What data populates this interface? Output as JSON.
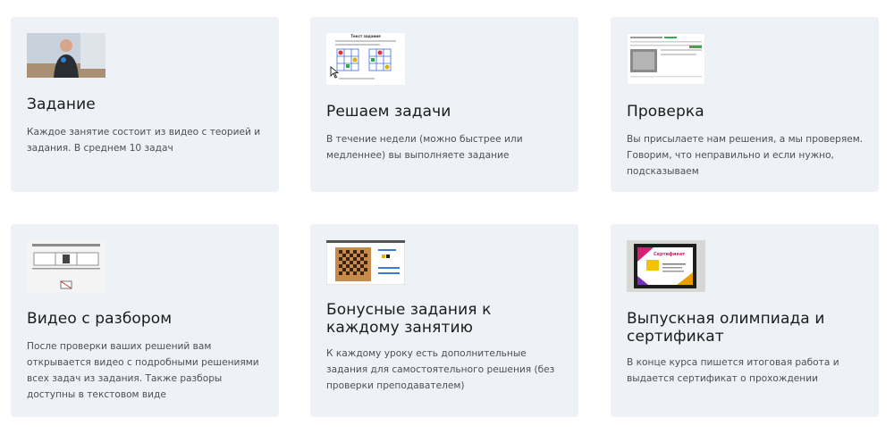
{
  "cards": [
    {
      "title": "Задание",
      "description": "Каждое занятие состоит из видео с теорией и задания. В среднем 10 задач",
      "image": "video-lesson-thumbnail"
    },
    {
      "title": "Решаем задачи",
      "description": "В течение недели (можно быстрее или медленнее) вы выполняете задание",
      "image": "worksheet-thumbnail",
      "image_text": "Текст задания"
    },
    {
      "title": "Проверка",
      "description": "Вы присылаете нам решения, а мы проверяем. Говорим, что неправильно и если нужно, подсказываем",
      "image": "review-screenshot-thumbnail"
    },
    {
      "title": "Видео с разбором",
      "description": "После проверки ваших решений вам открывается видео с подробными решениями всех задач из задания. Также разборы доступны в текстовом виде",
      "image": "solution-video-thumbnail"
    },
    {
      "title": "Бонусные задания к каждому занятию",
      "description": "К каждому уроку есть дополнительные задания для самостоятельного решения (без проверки преподавателем)",
      "image": "chessboard-thumbnail"
    },
    {
      "title": "Выпускная олимпиада и сертификат",
      "description": "В конце курса пишется итоговая работа и выдается сертификат о прохождении",
      "image": "certificate-thumbnail",
      "image_text": "Сертификат"
    }
  ],
  "colors": {
    "card_bg": "#eef1f6",
    "title": "#1b1b1b",
    "text": "#4d4f55"
  }
}
